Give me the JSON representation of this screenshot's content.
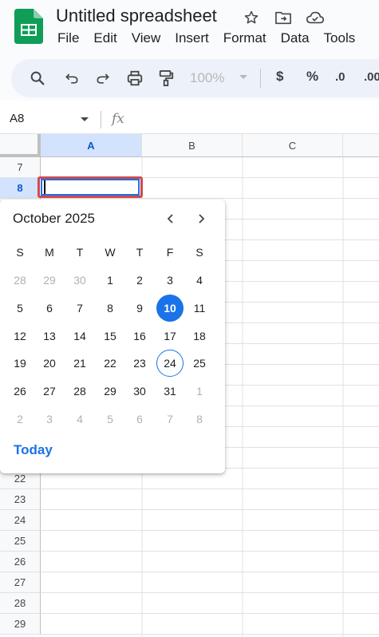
{
  "app": {
    "doc_title": "Untitled spreadsheet",
    "menu": [
      "File",
      "Edit",
      "View",
      "Insert",
      "Format",
      "Data",
      "Tools"
    ],
    "brand_color": "#0f9d58"
  },
  "toolbar": {
    "zoom": "100%",
    "currency": "$",
    "percent": "%",
    "decrease_decimal": ".0",
    "increase_decimal": ".00"
  },
  "formula_bar": {
    "name_box": "A8",
    "fx": "fx"
  },
  "grid": {
    "columns": [
      "A",
      "B",
      "C"
    ],
    "rows_top": [
      "7",
      "8"
    ],
    "rows_bottom": [
      "22",
      "23",
      "24",
      "25",
      "26",
      "27",
      "28",
      "29"
    ]
  },
  "datepicker": {
    "month_label": "October 2025",
    "weekdays": [
      "S",
      "M",
      "T",
      "W",
      "T",
      "F",
      "S"
    ],
    "weeks": [
      [
        "28",
        "29",
        "30",
        "1",
        "2",
        "3",
        "4"
      ],
      [
        "5",
        "6",
        "7",
        "8",
        "9",
        "10",
        "11"
      ],
      [
        "12",
        "13",
        "14",
        "15",
        "16",
        "17",
        "18"
      ],
      [
        "19",
        "20",
        "21",
        "22",
        "23",
        "24",
        "25"
      ],
      [
        "26",
        "27",
        "28",
        "29",
        "30",
        "31",
        "1"
      ],
      [
        "2",
        "3",
        "4",
        "5",
        "6",
        "7",
        "8"
      ]
    ],
    "selected_day": "10",
    "today_day": "24",
    "today_button": "Today",
    "accent_color": "#1a73e8"
  }
}
